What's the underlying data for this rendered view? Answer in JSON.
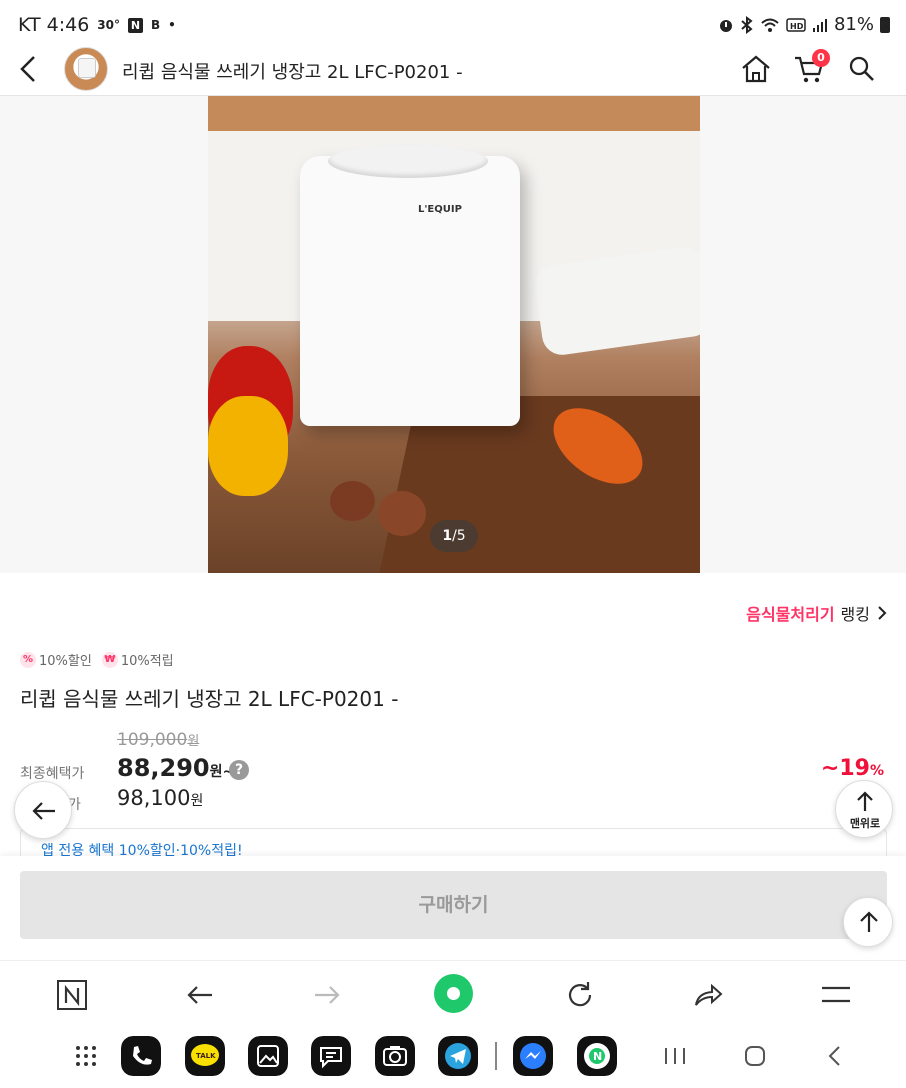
{
  "status": {
    "carrier_time": "KT 4:46",
    "temp": "30°",
    "n_badge": "N",
    "b_badge": "B",
    "dot": "•",
    "battery": "81%"
  },
  "header": {
    "title": "리큅 음식물 쓰레기 냉장고 2L LFC-P0201 -",
    "cart_count": "0"
  },
  "gallery": {
    "brand_text": "L'EQUIP",
    "current": "1",
    "total": "/5"
  },
  "ranking": {
    "category": "음식물처리기",
    "suffix": "랭킹"
  },
  "badges": {
    "discount_icon": "%",
    "discount": "10%할인",
    "points_icon": "₩",
    "points": "10%적립"
  },
  "product": {
    "title": "리큅 음식물 쓰레기 냉장고 2L LFC-P0201 -"
  },
  "price": {
    "original": "109,000",
    "original_unit": "원",
    "final_label": "최종혜택가",
    "final": "88,290",
    "final_unit": "원~",
    "help": "?",
    "discount_rate": "~19",
    "discount_pct": "%",
    "sale_label": "9%할인가",
    "sale": "98,100",
    "sale_unit": "원"
  },
  "benefit": {
    "text": "앱 전용 혜택 10%할인·10%적립!"
  },
  "floating": {
    "top_label": "맨위로"
  },
  "buy": {
    "label": "구매하기"
  },
  "colors": {
    "accent_pink": "#ff3366",
    "discount_red": "#f0113a",
    "benefit_blue": "#1976d2",
    "naver_green": "#1ec86b"
  }
}
